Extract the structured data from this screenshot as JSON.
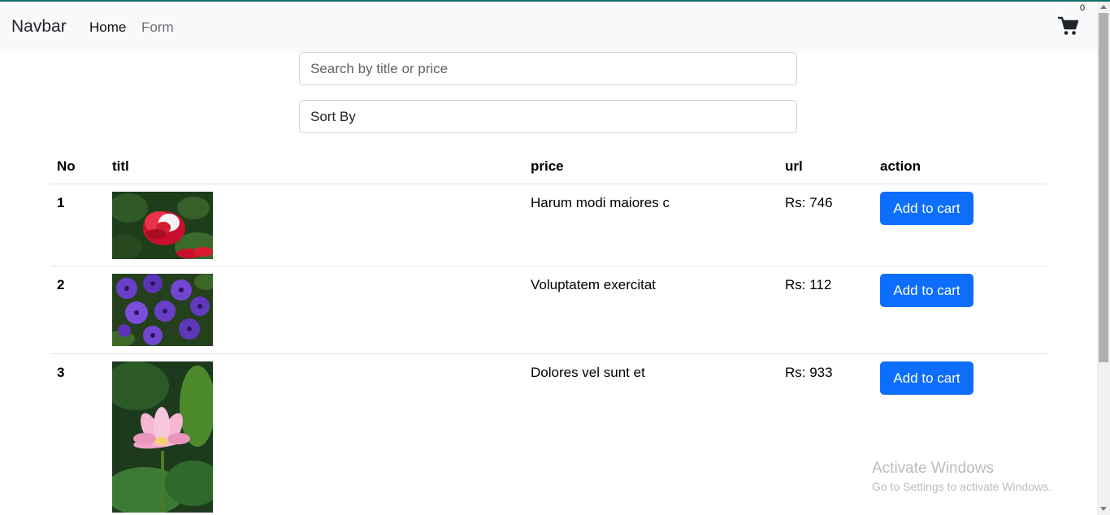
{
  "navbar": {
    "brand": "Navbar",
    "links": [
      "Home",
      "Form"
    ],
    "cart_count": "0",
    "cart_icon": "shopping-cart-icon"
  },
  "search": {
    "placeholder": "Search by title or price"
  },
  "sort": {
    "label": "Sort By"
  },
  "table": {
    "headers": [
      "No",
      "titl",
      "price",
      "url",
      "action"
    ],
    "rows": [
      {
        "no": "1",
        "image": "red-rose-image",
        "title": "Harum modi maiores c",
        "price": "Rs: 746",
        "action": "Add to cart"
      },
      {
        "no": "2",
        "image": "purple-petunias-image",
        "title": "Voluptatem exercitat",
        "price": "Rs: 112",
        "action": "Add to cart"
      },
      {
        "no": "3",
        "image": "pink-lotus-image",
        "title": "Dolores vel sunt et",
        "price": "Rs: 933",
        "action": "Add to cart"
      }
    ]
  },
  "watermark": {
    "line1": "Activate Windows",
    "line2": "Go to Settings to activate Windows."
  },
  "colors": {
    "primary": "#0d6efd",
    "navbar_bg": "#f8f9fa",
    "top_border": "#0f6e6e"
  }
}
